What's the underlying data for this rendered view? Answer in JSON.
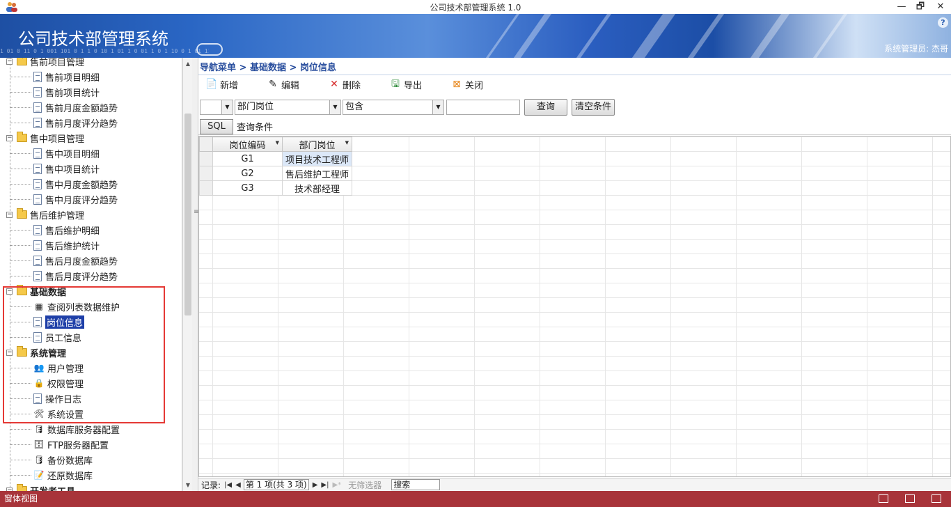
{
  "window": {
    "title": "公司技术部管理系统 1.0",
    "minimize": "—",
    "restore": "🗗",
    "close": "✕"
  },
  "banner": {
    "title": "公司技术部管理系统",
    "user": "系统管理员: 杰哥",
    "help": "?",
    "binary": "1 01 0 11 0 1 001 101 0 1 1 0 10 1 01 1 0 01 1 0 1 10 0 1 01 11 0 1"
  },
  "tree": {
    "nodes": [
      {
        "label": "售前项目管理",
        "type": "folder",
        "level": 0
      },
      {
        "label": "售前项目明细",
        "type": "doc",
        "level": 1
      },
      {
        "label": "售前项目统计",
        "type": "doc",
        "level": 1
      },
      {
        "label": "售前月度金额趋势",
        "type": "doc",
        "level": 1
      },
      {
        "label": "售前月度评分趋势",
        "type": "doc",
        "level": 1
      },
      {
        "label": "售中项目管理",
        "type": "folder",
        "level": 0
      },
      {
        "label": "售中项目明细",
        "type": "doc",
        "level": 1
      },
      {
        "label": "售中项目统计",
        "type": "doc",
        "level": 1
      },
      {
        "label": "售中月度金额趋势",
        "type": "doc",
        "level": 1
      },
      {
        "label": "售中月度评分趋势",
        "type": "doc",
        "level": 1
      },
      {
        "label": "售后维护管理",
        "type": "folder",
        "level": 0
      },
      {
        "label": "售后维护明细",
        "type": "doc",
        "level": 1
      },
      {
        "label": "售后维护统计",
        "type": "doc",
        "level": 1
      },
      {
        "label": "售后月度金额趋势",
        "type": "doc",
        "level": 1
      },
      {
        "label": "售后月度评分趋势",
        "type": "doc",
        "level": 1
      },
      {
        "label": "基础数据",
        "type": "folder",
        "level": 0,
        "bold": true
      },
      {
        "label": "查阅列表数据维护",
        "type": "table",
        "level": 1
      },
      {
        "label": "岗位信息",
        "type": "doc",
        "level": 1,
        "selected": true
      },
      {
        "label": "员工信息",
        "type": "doc",
        "level": 1
      },
      {
        "label": "系统管理",
        "type": "folder",
        "level": 0,
        "bold": true
      },
      {
        "label": "用户管理",
        "type": "users",
        "level": 1
      },
      {
        "label": "权限管理",
        "type": "lock",
        "level": 1
      },
      {
        "label": "操作日志",
        "type": "doc",
        "level": 1
      },
      {
        "label": "系统设置",
        "type": "settings",
        "level": 1
      },
      {
        "label": "数据库服务器配置",
        "type": "db",
        "level": 1
      },
      {
        "label": "FTP服务器配置",
        "type": "server",
        "level": 1
      },
      {
        "label": "备份数据库",
        "type": "db",
        "level": 1
      },
      {
        "label": "还原数据库",
        "type": "restore",
        "level": 1
      },
      {
        "label": "开发者工具",
        "type": "folder",
        "level": 0,
        "bold": true
      }
    ],
    "selected": "岗位信息",
    "icons": {
      "users": "👥",
      "lock": "🔒",
      "settings": "🛠",
      "db": "🛢",
      "server": "🗄",
      "restore": "📝",
      "table": "▦"
    }
  },
  "breadcrumb": "导航菜单 > 基础数据 > 岗位信息",
  "toolbar": [
    {
      "label": "新增",
      "icon": "📄"
    },
    {
      "label": "编辑",
      "icon": "✎"
    },
    {
      "label": "删除",
      "icon": "✕"
    },
    {
      "label": "导出",
      "icon": "🖫"
    },
    {
      "label": "关闭",
      "icon": "⊠"
    }
  ],
  "filter": {
    "first_combo": "",
    "field_combo": "部门岗位",
    "operator_combo": "包含",
    "value": "",
    "query_button": "查询",
    "clear_button": "清空条件"
  },
  "sql": {
    "button": "SQL",
    "label": "查询条件"
  },
  "grid": {
    "columns": [
      "岗位编码",
      "部门岗位"
    ],
    "rows": [
      {
        "code": "G1",
        "position": "项目技术工程师"
      },
      {
        "code": "G2",
        "position": "售后维护工程师"
      },
      {
        "code": "G3",
        "position": "技术部经理"
      }
    ]
  },
  "pager": {
    "records_label": "记录:",
    "page_text": "第 1 项(共 3 项)",
    "no_filter": "无筛选器",
    "search": "搜索"
  },
  "status": {
    "text": "窗体视图"
  }
}
